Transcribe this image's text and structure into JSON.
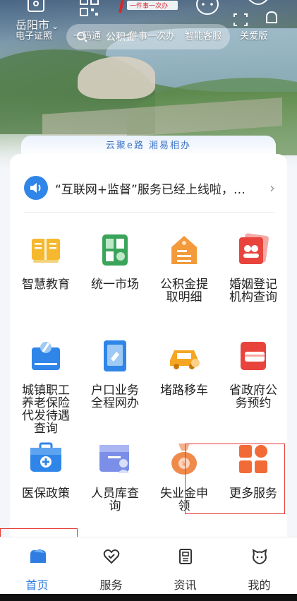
{
  "header": {
    "city": "岳阳市",
    "search_placeholder": "公积金",
    "quick_icons": [
      {
        "label": "电子证照",
        "icon": "id-card-icon"
      },
      {
        "label": "一码通",
        "icon": "qr-code-icon"
      },
      {
        "label": "一件事一次办",
        "icon": "one-thing-logo-icon"
      },
      {
        "label": "智能客服",
        "icon": "robot-icon"
      },
      {
        "label": "关爱版",
        "icon": "elderly-care-icon"
      }
    ],
    "logo_text": "一件事一次办"
  },
  "slogan": "云聚e路 湘易相办",
  "notice": {
    "text": "“互联网+监督”服务已经上线啦，…",
    "icon": "speaker-icon"
  },
  "services": [
    {
      "label": "智慧教育",
      "icon": "book-icon",
      "color": "#f5b82e"
    },
    {
      "label": "统一市场",
      "icon": "market-icon",
      "color": "#3aa55a"
    },
    {
      "label": "公积金提取明细",
      "icon": "house-fund-icon",
      "color": "#f39a3c"
    },
    {
      "label": "婚姻登记机构查询",
      "icon": "marriage-icon",
      "color": "#e8443c"
    },
    {
      "label": "城镇职工养老保险代发待遇查询",
      "icon": "pension-icon",
      "color": "#2f86e8"
    },
    {
      "label": "户口业务全程网办",
      "icon": "household-icon",
      "color": "#2f86e8"
    },
    {
      "label": "堵路移车",
      "icon": "car-icon",
      "color": "#f5a623"
    },
    {
      "label": "省政府公务预约",
      "icon": "card-icon",
      "color": "#e8443c"
    },
    {
      "label": "医保政策",
      "icon": "medical-kit-icon",
      "color": "#2f86e8"
    },
    {
      "label": "人员库查询",
      "icon": "person-db-icon",
      "color": "#7b8fe8"
    },
    {
      "label": "失业金申领",
      "icon": "money-bag-icon",
      "color": "#f08a4b"
    },
    {
      "label": "更多服务",
      "icon": "grid-more-icon",
      "color": "#f26a36"
    }
  ],
  "tabs": [
    {
      "label": "首页",
      "icon": "home-icon",
      "active": true
    },
    {
      "label": "服务",
      "icon": "heart-service-icon",
      "active": false
    },
    {
      "label": "资讯",
      "icon": "news-icon",
      "active": false
    },
    {
      "label": "我的",
      "icon": "profile-icon",
      "active": false
    }
  ],
  "colors": {
    "accent": "#2f7de1",
    "highlight_box": "#e53935"
  }
}
